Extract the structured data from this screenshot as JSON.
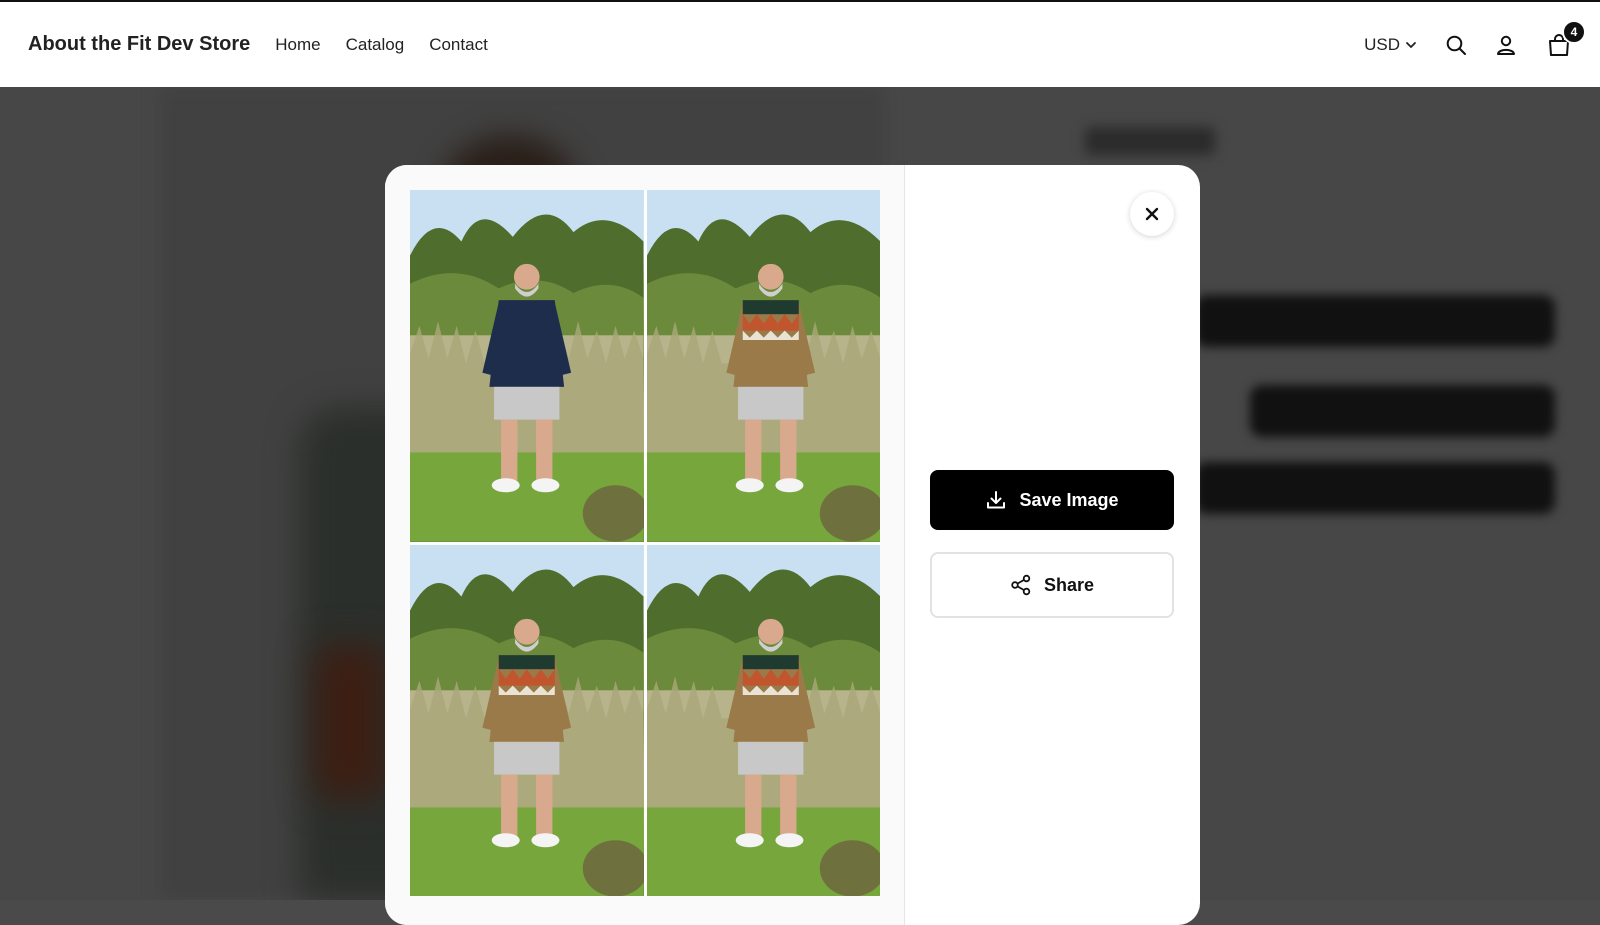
{
  "header": {
    "store_name": "About the Fit Dev Store",
    "nav": [
      {
        "label": "Home"
      },
      {
        "label": "Catalog"
      },
      {
        "label": "Contact"
      }
    ],
    "currency": "USD",
    "icons": [
      "search-icon",
      "account-icon",
      "cart-icon"
    ],
    "cart_count": "4"
  },
  "modal": {
    "collage": {
      "panels": [
        {
          "sweater": "navy",
          "sweater_color": "#1f2d4d"
        },
        {
          "sweater": "fair-isle",
          "sweater_color": "#9b7a4a"
        },
        {
          "sweater": "fair-isle",
          "sweater_color": "#9b7a4a"
        },
        {
          "sweater": "fair-isle",
          "sweater_color": "#9b7a4a"
        }
      ]
    },
    "save_label": "Save Image",
    "share_label": "Share",
    "close_icon": "close-icon"
  },
  "colors": {
    "primary_button": "#000000",
    "overlay": "#474747",
    "header_bg": "#ffffff"
  }
}
